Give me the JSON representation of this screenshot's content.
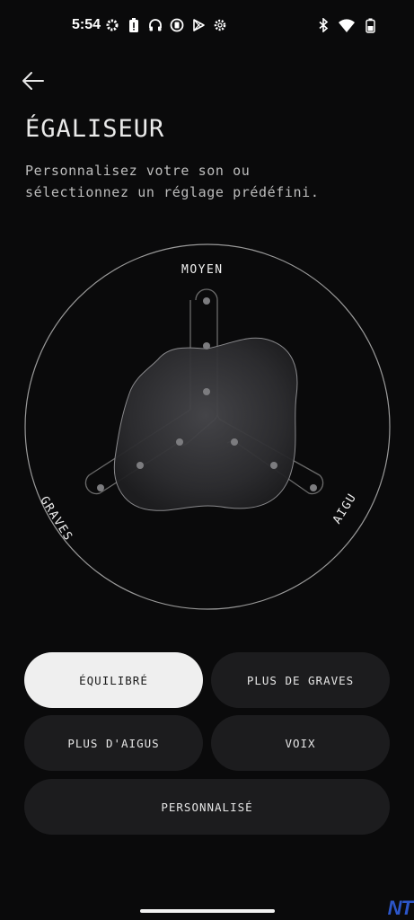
{
  "status_bar": {
    "time": "5:54",
    "left_icons": [
      "settings-icon",
      "alert-battery-icon",
      "headphones-icon",
      "app-shield-icon",
      "play-store-icon",
      "settings-icon"
    ],
    "right_icons": [
      "bluetooth-icon",
      "wifi-icon",
      "battery-icon"
    ]
  },
  "header": {
    "title": "ÉGALISEUR",
    "subtitle_line1": "Personnalisez votre son ou",
    "subtitle_line2": "sélectionnez un réglage prédéfini."
  },
  "equalizer": {
    "labels": {
      "mid": "MOYEN",
      "bass": "GRAVES",
      "treble": "AIGU"
    },
    "levels": {
      "bass": 0,
      "mid": 0,
      "treble": 0
    },
    "colors": {
      "ring": "#9a9a9a",
      "arm": "#6b6b6b",
      "blob": "#3a3a3d"
    }
  },
  "presets": {
    "balanced": "ÉQUILIBRÉ",
    "more_bass": "PLUS DE GRAVES",
    "more_treble": "PLUS D'AIGUS",
    "voice": "VOIX",
    "custom": "PERSONNALISÉ",
    "selected": "balanced"
  },
  "watermark": "NT",
  "colors": {
    "background": "#0a0a0b",
    "button": "#1c1c1e",
    "button_active": "#efefef"
  }
}
